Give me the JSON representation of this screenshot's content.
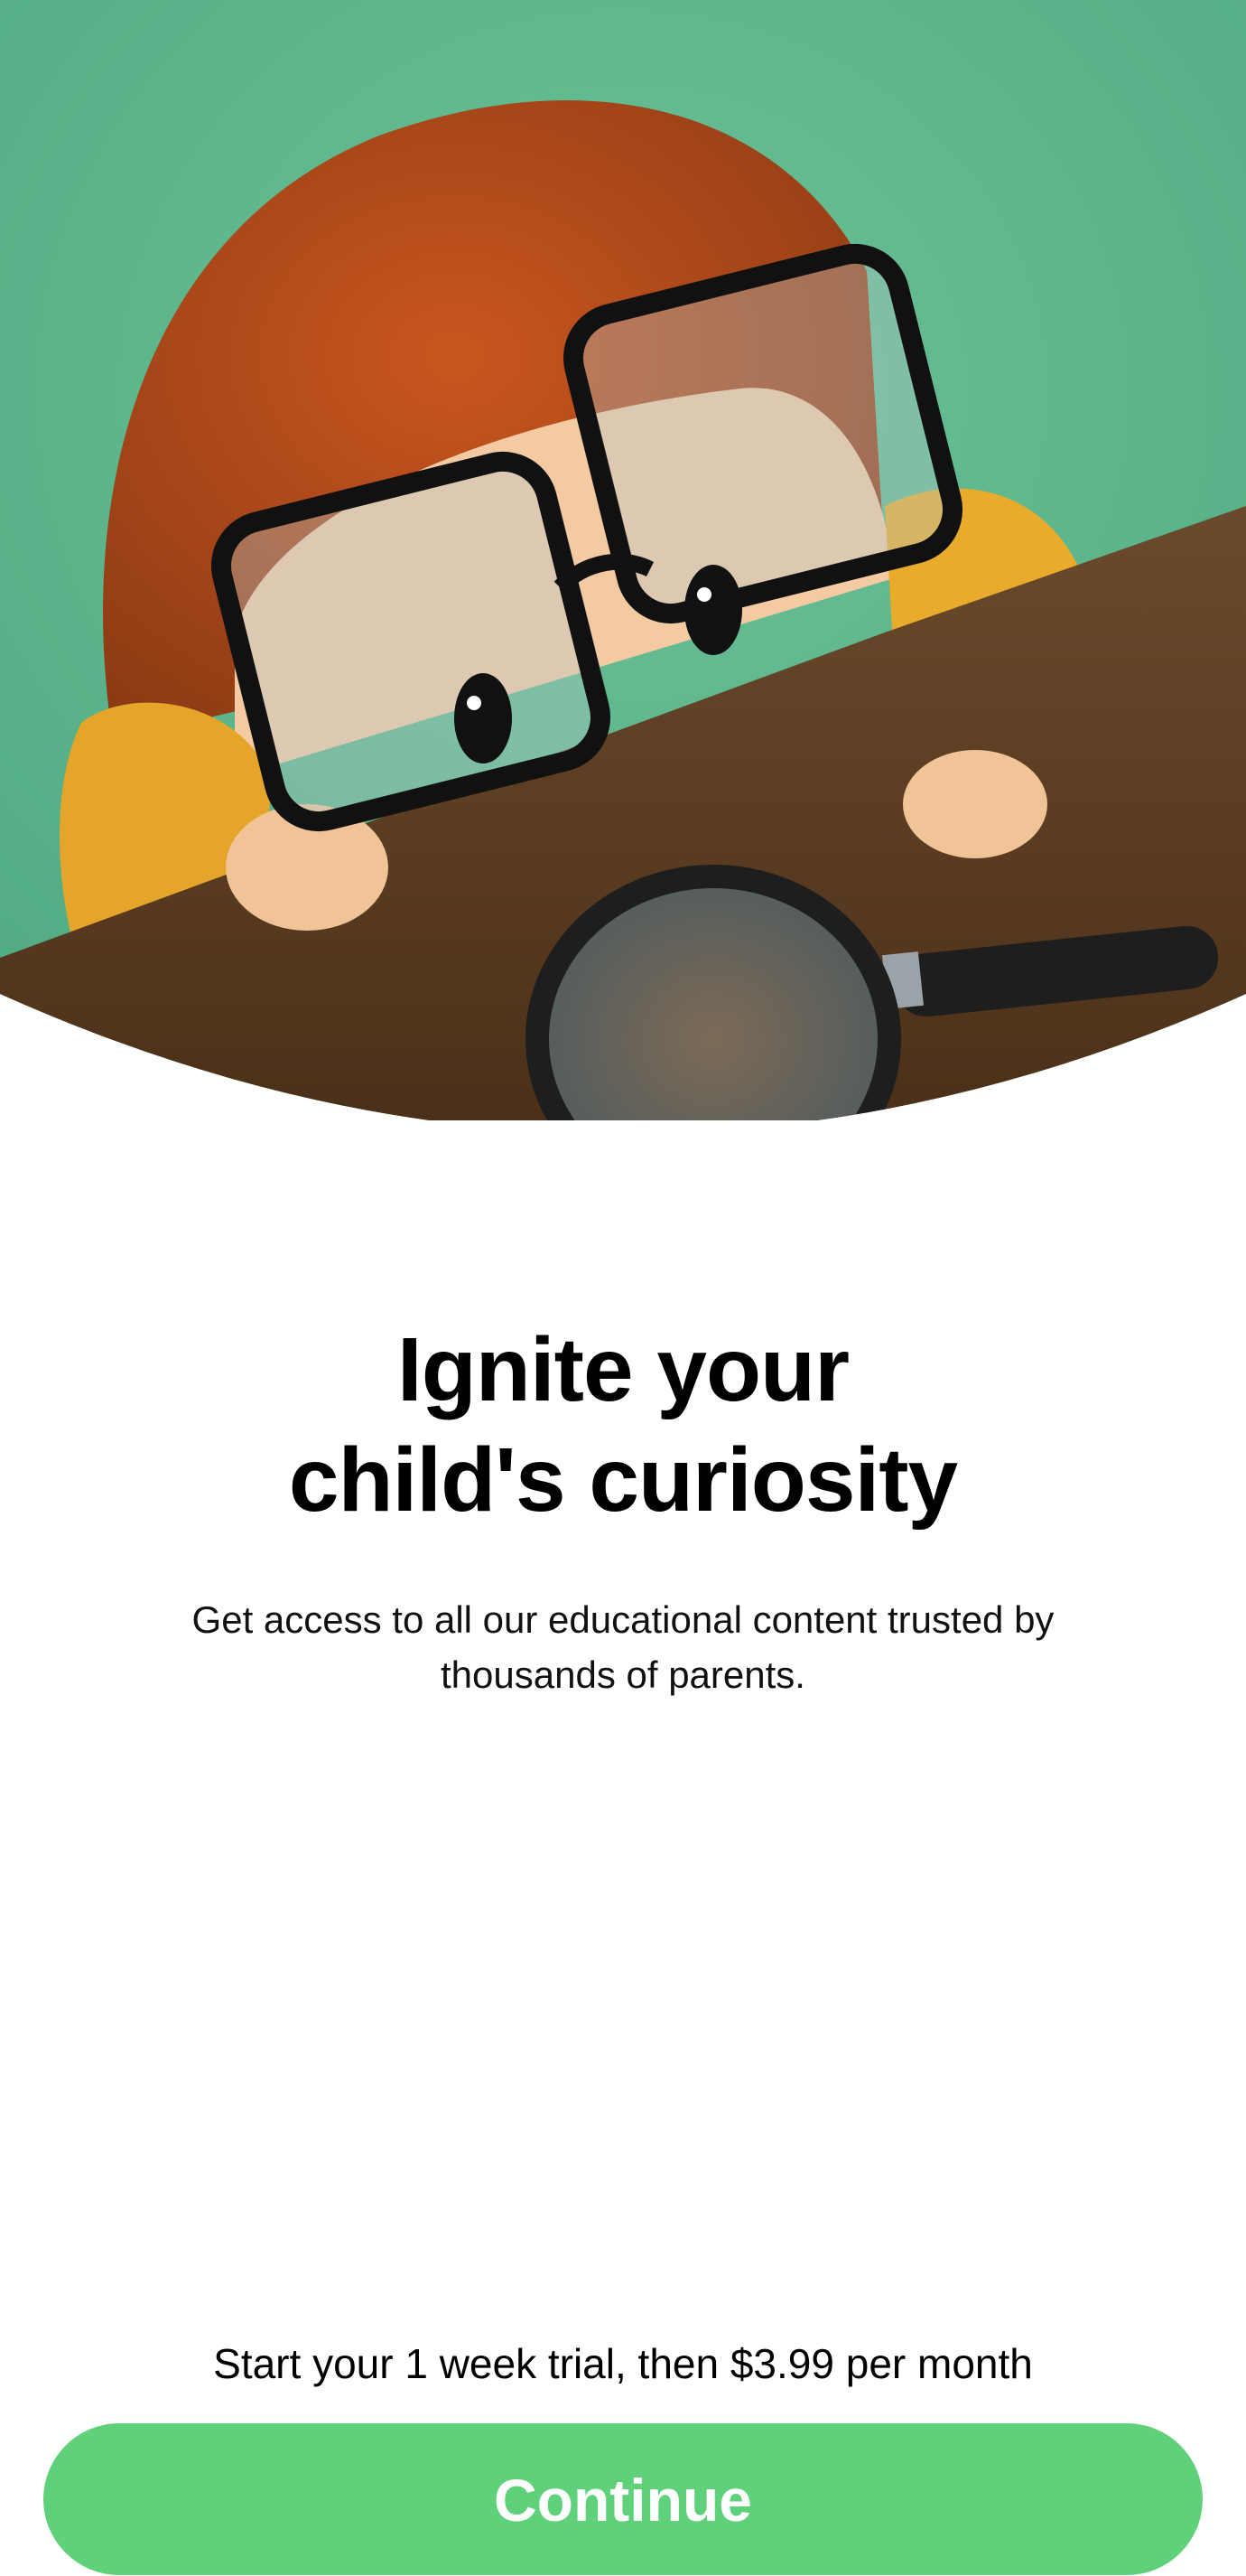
{
  "colors": {
    "background": "#ffffff",
    "hero_green": "#5fb98a",
    "button_green": "#5fd17a",
    "button_text": "#ffffff",
    "text": "#000000"
  },
  "hero": {
    "illustration": "child-with-glasses-peeking-over-table-with-magnifying-glass-illustration"
  },
  "headline": {
    "line1": "Ignite your",
    "line2": "child's curiosity"
  },
  "subtitle": "Get access to all our educational content trusted by thousands of parents.",
  "trial_text": "Start your 1 week trial, then $3.99 per month",
  "continue_label": "Continue"
}
